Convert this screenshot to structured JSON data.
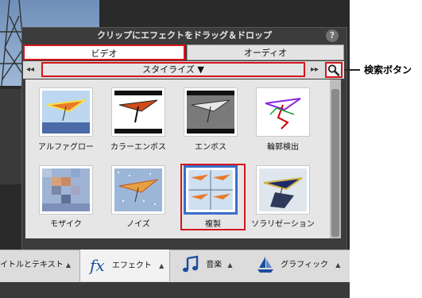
{
  "panel": {
    "title": "クリップにエフェクトをドラッグ＆ドロップ",
    "help_icon": "?",
    "tabs": [
      {
        "label": "ビデオ",
        "selected": true
      },
      {
        "label": "オーディオ",
        "selected": false
      }
    ],
    "category": {
      "value": "スタイライズ ▼",
      "prev_icon": "◂◂",
      "next_icon": "▸▸"
    },
    "search_icon": "magnifier-icon",
    "effects": [
      {
        "label": "アルファグロー"
      },
      {
        "label": "カラーエンボス"
      },
      {
        "label": "エンボス"
      },
      {
        "label": "輪郭検出"
      },
      {
        "label": "モザイク"
      },
      {
        "label": "ノイズ"
      },
      {
        "label": "複製",
        "selected": true
      },
      {
        "label": "ソラリゼーション"
      }
    ]
  },
  "callout": {
    "label": "検索ボタン"
  },
  "bottom_bar": {
    "items": [
      {
        "label": "イトルとテキスト",
        "icon": "text-icon"
      },
      {
        "label": "エフェクト",
        "icon": "fx-icon",
        "icon_text": "fx",
        "selected": true
      },
      {
        "label": "音楽",
        "icon": "music-note-icon"
      },
      {
        "label": "グラフィック",
        "icon": "sailboat-icon"
      }
    ],
    "caret": "▲"
  },
  "colors": {
    "highlight": "#d4161c",
    "panel_bg": "#3c3c3c",
    "grid_bg": "#e6e6e6"
  }
}
